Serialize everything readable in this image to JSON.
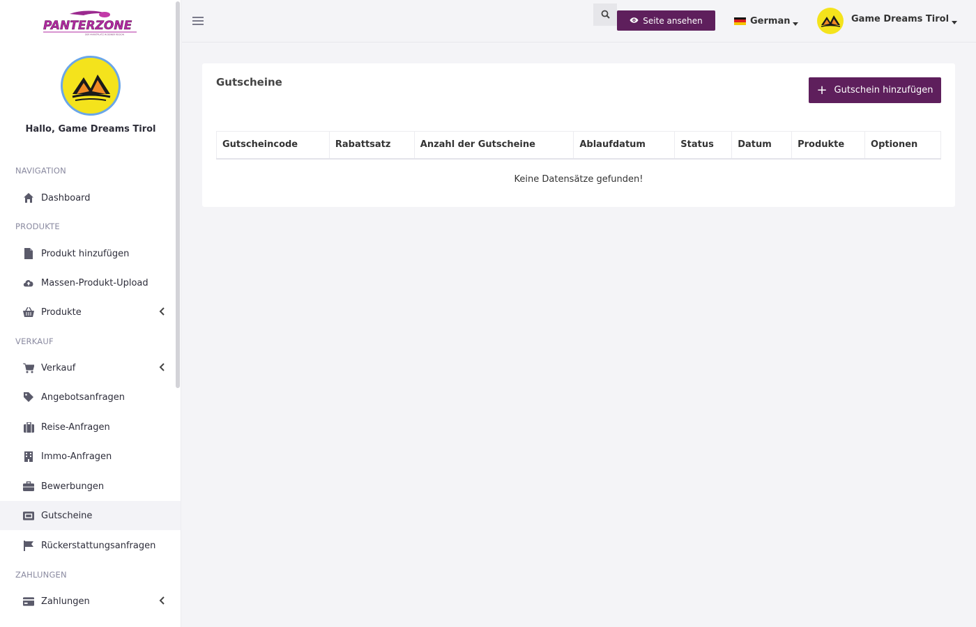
{
  "brand": {
    "logo_text": "PANTERZONE",
    "tagline": "DER MARKTPLATZ IN DEINER REGION"
  },
  "sidebar": {
    "greeting": "Hallo, Game Dreams Tirol",
    "sections": {
      "navigation": "NAVIGATION",
      "produkte": "PRODUKTE",
      "verkauf": "VERKAUF",
      "zahlungen": "ZAHLUNGEN"
    },
    "items": [
      {
        "label": "Dashboard",
        "icon": "home-icon"
      },
      {
        "label": "Produkt hinzufügen",
        "icon": "file-icon"
      },
      {
        "label": "Massen-Produkt-Upload",
        "icon": "cloud-upload-icon"
      },
      {
        "label": "Produkte",
        "icon": "basket-icon"
      },
      {
        "label": "Verkauf",
        "icon": "cart-icon"
      },
      {
        "label": "Angebotsanfragen",
        "icon": "tag-icon"
      },
      {
        "label": "Reise-Anfragen",
        "icon": "suitcase-icon"
      },
      {
        "label": "Immo-Anfragen",
        "icon": "building-icon"
      },
      {
        "label": "Bewerbungen",
        "icon": "briefcase-icon"
      },
      {
        "label": "Gutscheine",
        "icon": "ticket-icon"
      },
      {
        "label": "Rückerstattungsanfragen",
        "icon": "flag-icon"
      },
      {
        "label": "Zahlungen",
        "icon": "credit-card-icon"
      }
    ],
    "active": "Gutscheine"
  },
  "topbar": {
    "view_site": "Seite ansehen",
    "language": "German",
    "user_name": "Game Dreams Tirol"
  },
  "card": {
    "title": "Gutscheine",
    "add_button": "Gutschein hinzufügen",
    "columns": [
      "Gutscheincode",
      "Rabattsatz",
      "Anzahl der Gutscheine",
      "Ablaufdatum",
      "Status",
      "Datum",
      "Produkte",
      "Optionen"
    ],
    "empty_message": "Keine Datensätze gefunden!"
  },
  "colors": {
    "accent": "#5e1f5c",
    "background": "#f4f4f7"
  }
}
